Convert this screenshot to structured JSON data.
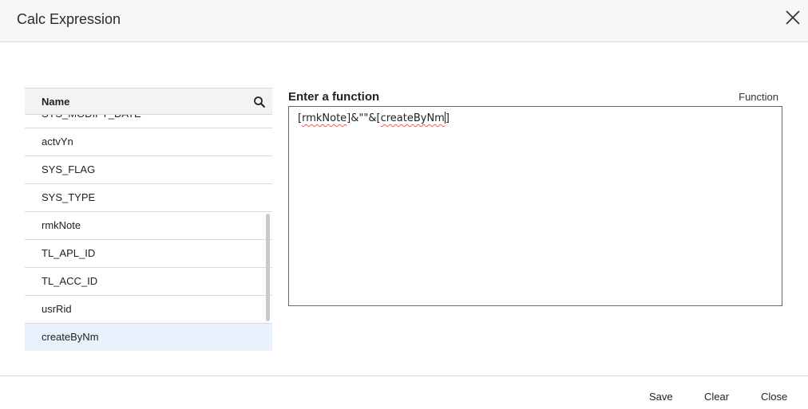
{
  "dialog": {
    "title": "Calc Expression",
    "close_icon": "close-icon"
  },
  "list": {
    "header": "Name",
    "search_icon": "search-icon",
    "items": [
      {
        "label": "SYS_MODIFY_DATE"
      },
      {
        "label": "actvYn"
      },
      {
        "label": "SYS_FLAG"
      },
      {
        "label": "SYS_TYPE"
      },
      {
        "label": "rmkNote"
      },
      {
        "label": "TL_APL_ID"
      },
      {
        "label": "TL_ACC_ID"
      },
      {
        "label": "usrRid"
      },
      {
        "label": "createByNm"
      }
    ],
    "selected": "createByNm"
  },
  "function_editor": {
    "label": "Enter a function",
    "function_link": "Function",
    "expression": {
      "open1": "[",
      "field1": "rmkNote",
      "mid": "]&\"\"&[",
      "field2": "createByNm",
      "close2": "]"
    }
  },
  "footer": {
    "save": "Save",
    "clear": "Clear",
    "close": "Close"
  },
  "colors": {
    "selected_row": "#e8f1fc",
    "editor_border": "#4f6b8a",
    "spellcheck": "#e06060"
  }
}
